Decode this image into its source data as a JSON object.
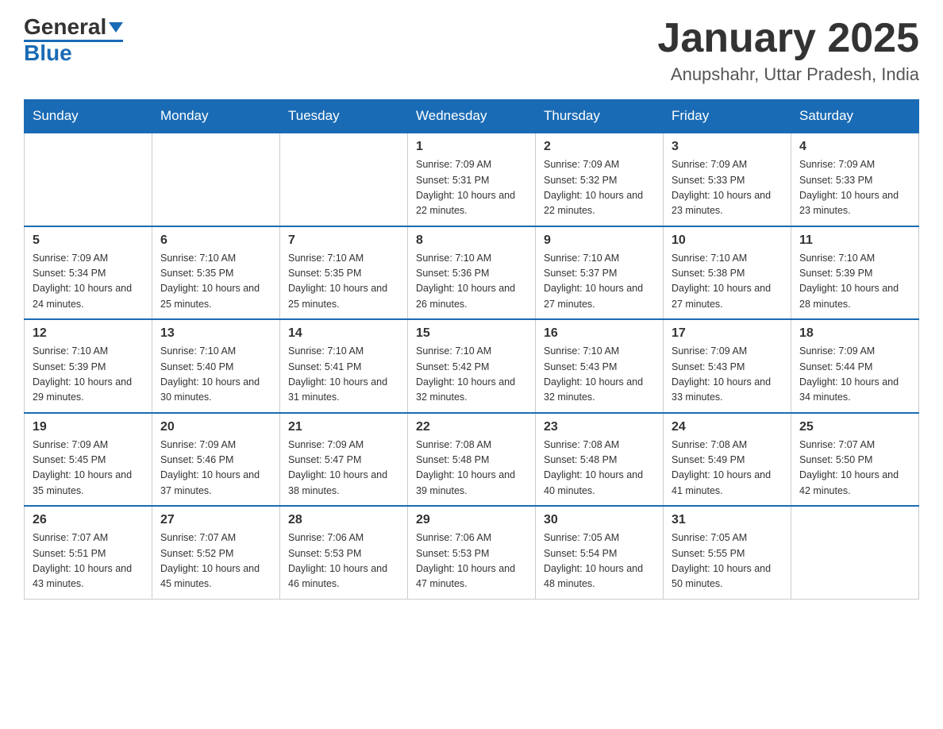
{
  "header": {
    "logo_general": "General",
    "logo_blue": "Blue",
    "month_title": "January 2025",
    "location": "Anupshahr, Uttar Pradesh, India"
  },
  "days_of_week": [
    "Sunday",
    "Monday",
    "Tuesday",
    "Wednesday",
    "Thursday",
    "Friday",
    "Saturday"
  ],
  "weeks": [
    [
      {
        "day": "",
        "info": ""
      },
      {
        "day": "",
        "info": ""
      },
      {
        "day": "",
        "info": ""
      },
      {
        "day": "1",
        "info": "Sunrise: 7:09 AM\nSunset: 5:31 PM\nDaylight: 10 hours\nand 22 minutes."
      },
      {
        "day": "2",
        "info": "Sunrise: 7:09 AM\nSunset: 5:32 PM\nDaylight: 10 hours\nand 22 minutes."
      },
      {
        "day": "3",
        "info": "Sunrise: 7:09 AM\nSunset: 5:33 PM\nDaylight: 10 hours\nand 23 minutes."
      },
      {
        "day": "4",
        "info": "Sunrise: 7:09 AM\nSunset: 5:33 PM\nDaylight: 10 hours\nand 23 minutes."
      }
    ],
    [
      {
        "day": "5",
        "info": "Sunrise: 7:09 AM\nSunset: 5:34 PM\nDaylight: 10 hours\nand 24 minutes."
      },
      {
        "day": "6",
        "info": "Sunrise: 7:10 AM\nSunset: 5:35 PM\nDaylight: 10 hours\nand 25 minutes."
      },
      {
        "day": "7",
        "info": "Sunrise: 7:10 AM\nSunset: 5:35 PM\nDaylight: 10 hours\nand 25 minutes."
      },
      {
        "day": "8",
        "info": "Sunrise: 7:10 AM\nSunset: 5:36 PM\nDaylight: 10 hours\nand 26 minutes."
      },
      {
        "day": "9",
        "info": "Sunrise: 7:10 AM\nSunset: 5:37 PM\nDaylight: 10 hours\nand 27 minutes."
      },
      {
        "day": "10",
        "info": "Sunrise: 7:10 AM\nSunset: 5:38 PM\nDaylight: 10 hours\nand 27 minutes."
      },
      {
        "day": "11",
        "info": "Sunrise: 7:10 AM\nSunset: 5:39 PM\nDaylight: 10 hours\nand 28 minutes."
      }
    ],
    [
      {
        "day": "12",
        "info": "Sunrise: 7:10 AM\nSunset: 5:39 PM\nDaylight: 10 hours\nand 29 minutes."
      },
      {
        "day": "13",
        "info": "Sunrise: 7:10 AM\nSunset: 5:40 PM\nDaylight: 10 hours\nand 30 minutes."
      },
      {
        "day": "14",
        "info": "Sunrise: 7:10 AM\nSunset: 5:41 PM\nDaylight: 10 hours\nand 31 minutes."
      },
      {
        "day": "15",
        "info": "Sunrise: 7:10 AM\nSunset: 5:42 PM\nDaylight: 10 hours\nand 32 minutes."
      },
      {
        "day": "16",
        "info": "Sunrise: 7:10 AM\nSunset: 5:43 PM\nDaylight: 10 hours\nand 32 minutes."
      },
      {
        "day": "17",
        "info": "Sunrise: 7:09 AM\nSunset: 5:43 PM\nDaylight: 10 hours\nand 33 minutes."
      },
      {
        "day": "18",
        "info": "Sunrise: 7:09 AM\nSunset: 5:44 PM\nDaylight: 10 hours\nand 34 minutes."
      }
    ],
    [
      {
        "day": "19",
        "info": "Sunrise: 7:09 AM\nSunset: 5:45 PM\nDaylight: 10 hours\nand 35 minutes."
      },
      {
        "day": "20",
        "info": "Sunrise: 7:09 AM\nSunset: 5:46 PM\nDaylight: 10 hours\nand 37 minutes."
      },
      {
        "day": "21",
        "info": "Sunrise: 7:09 AM\nSunset: 5:47 PM\nDaylight: 10 hours\nand 38 minutes."
      },
      {
        "day": "22",
        "info": "Sunrise: 7:08 AM\nSunset: 5:48 PM\nDaylight: 10 hours\nand 39 minutes."
      },
      {
        "day": "23",
        "info": "Sunrise: 7:08 AM\nSunset: 5:48 PM\nDaylight: 10 hours\nand 40 minutes."
      },
      {
        "day": "24",
        "info": "Sunrise: 7:08 AM\nSunset: 5:49 PM\nDaylight: 10 hours\nand 41 minutes."
      },
      {
        "day": "25",
        "info": "Sunrise: 7:07 AM\nSunset: 5:50 PM\nDaylight: 10 hours\nand 42 minutes."
      }
    ],
    [
      {
        "day": "26",
        "info": "Sunrise: 7:07 AM\nSunset: 5:51 PM\nDaylight: 10 hours\nand 43 minutes."
      },
      {
        "day": "27",
        "info": "Sunrise: 7:07 AM\nSunset: 5:52 PM\nDaylight: 10 hours\nand 45 minutes."
      },
      {
        "day": "28",
        "info": "Sunrise: 7:06 AM\nSunset: 5:53 PM\nDaylight: 10 hours\nand 46 minutes."
      },
      {
        "day": "29",
        "info": "Sunrise: 7:06 AM\nSunset: 5:53 PM\nDaylight: 10 hours\nand 47 minutes."
      },
      {
        "day": "30",
        "info": "Sunrise: 7:05 AM\nSunset: 5:54 PM\nDaylight: 10 hours\nand 48 minutes."
      },
      {
        "day": "31",
        "info": "Sunrise: 7:05 AM\nSunset: 5:55 PM\nDaylight: 10 hours\nand 50 minutes."
      },
      {
        "day": "",
        "info": ""
      }
    ]
  ]
}
